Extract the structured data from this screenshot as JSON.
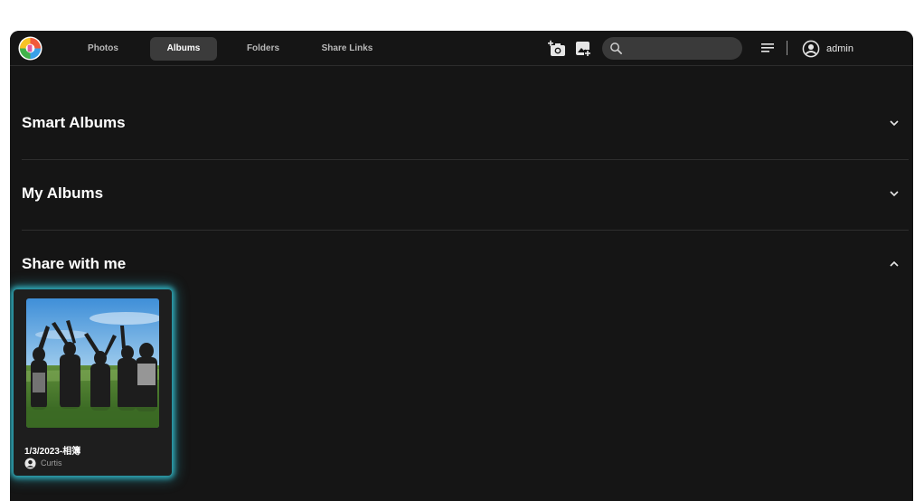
{
  "nav": {
    "tabs": [
      {
        "label": "Photos",
        "active": false
      },
      {
        "label": "Albums",
        "active": true
      },
      {
        "label": "Folders",
        "active": false
      },
      {
        "label": "Share Links",
        "active": false
      }
    ]
  },
  "toolbar": {
    "icons": [
      "add-camera-icon",
      "add-photo-icon",
      "sort-icon"
    ],
    "search": {
      "placeholder": "",
      "value": ""
    },
    "user": {
      "name": "admin",
      "icon": "account-circle-icon"
    }
  },
  "sections": [
    {
      "title": "Smart Albums",
      "expanded": false
    },
    {
      "title": "My Albums",
      "expanded": false
    },
    {
      "title": "Share with me",
      "expanded": true
    }
  ],
  "shared_albums": [
    {
      "title": "1/3/2023-相簿",
      "owner": "Curtis",
      "selected": true
    }
  ],
  "colors": {
    "background": "#151515",
    "active_tab": "#3b3b3b",
    "search_bg": "#3a3a3a",
    "selection_glow": "#2fa8b7"
  }
}
